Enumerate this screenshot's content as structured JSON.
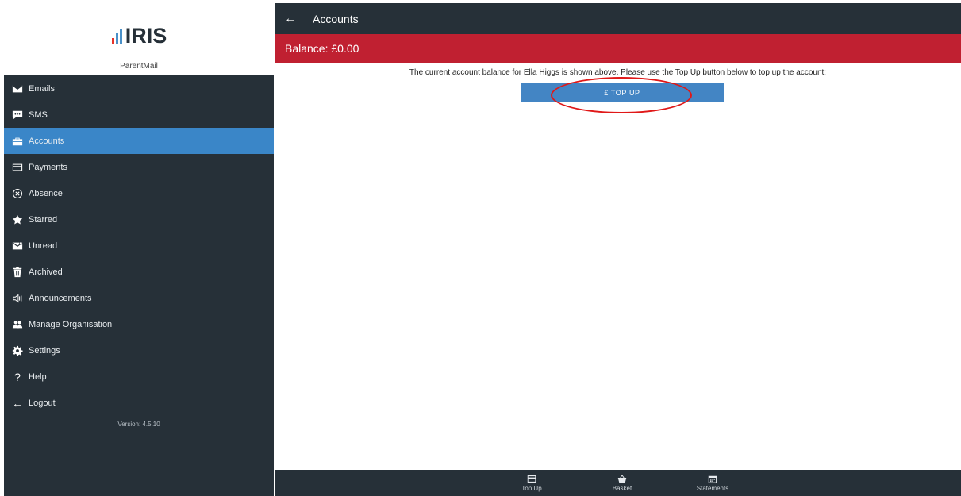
{
  "brand": {
    "logo_text": "IRIS",
    "org_name": "ParentMail"
  },
  "nav": {
    "items": [
      {
        "label": "Emails",
        "icon": "envelope-icon"
      },
      {
        "label": "SMS",
        "icon": "chat-icon"
      },
      {
        "label": "Accounts",
        "icon": "briefcase-icon",
        "active": true
      },
      {
        "label": "Payments",
        "icon": "credit-card-icon"
      },
      {
        "label": "Absence",
        "icon": "circle-x-icon"
      },
      {
        "label": "Starred",
        "icon": "star-icon"
      },
      {
        "label": "Unread",
        "icon": "mail-unread-icon"
      },
      {
        "label": "Archived",
        "icon": "trash-icon"
      },
      {
        "label": "Announcements",
        "icon": "speaker-icon"
      },
      {
        "label": "Manage Organisation",
        "icon": "users-icon"
      },
      {
        "label": "Settings",
        "icon": "gear-icon"
      },
      {
        "label": "Help",
        "icon": "question-icon"
      },
      {
        "label": "Logout",
        "icon": "arrow-left-icon"
      }
    ],
    "version": "Version: 4.5.10"
  },
  "topbar": {
    "back_icon": "←",
    "title": "Accounts"
  },
  "balance": {
    "text": "Balance: £0.00"
  },
  "content": {
    "info_text": "The current account balance for Ella Higgs is shown above. Please use the Top Up button below to top up the account:",
    "topup_label": "£ TOP UP"
  },
  "bottom_nav": {
    "items": [
      {
        "label": "Top Up",
        "icon": "card-icon"
      },
      {
        "label": "Basket",
        "icon": "basket-icon"
      },
      {
        "label": "Statements",
        "icon": "calendar-icon"
      }
    ]
  },
  "colors": {
    "sidebar_bg": "#263038",
    "active_item": "#3a86c8",
    "balance_bar": "#c02031",
    "button": "#4385c4",
    "highlight_ring": "#e01818"
  }
}
